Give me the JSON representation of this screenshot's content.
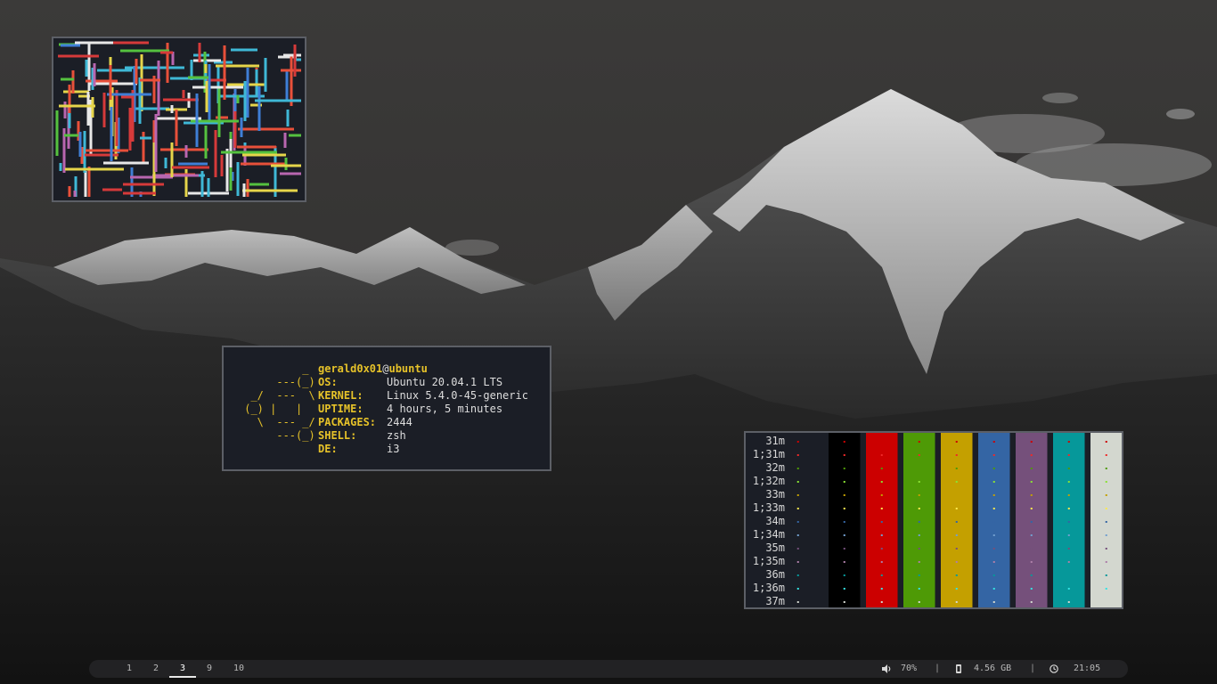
{
  "wallpaper": {
    "description_icon": "mountain-wallpaper"
  },
  "neofetch": {
    "logo_lines": [
      "          _",
      "      ---(_)",
      "  _/  ---  \\",
      " (_) |   |",
      "   \\  --- _/",
      "      ---(_)"
    ],
    "user": "gerald0x01",
    "at": "@",
    "host": "ubuntu",
    "rows": [
      {
        "key": "OS:",
        "value": "Ubuntu 20.04.1 LTS"
      },
      {
        "key": "KERNEL:",
        "value": "Linux 5.4.0-45-generic"
      },
      {
        "key": "UPTIME:",
        "value": "4 hours, 5 minutes"
      },
      {
        "key": "PACKAGES:",
        "value": "2444"
      },
      {
        "key": "SHELL:",
        "value": "zsh"
      },
      {
        "key": "DE:",
        "value": "i3"
      }
    ]
  },
  "colortest": {
    "labels": [
      "31m",
      "1;31m",
      "32m",
      "1;32m",
      "33m",
      "1;33m",
      "34m",
      "1;34m",
      "35m",
      "1;35m",
      "36m",
      "1;36m",
      "37m"
    ],
    "backgrounds": [
      "#1b1e26",
      "#000000",
      "#cc0000",
      "#4e9a06",
      "#c4a000",
      "#3465a4",
      "#75507b",
      "#06989a",
      "#d3d7cf"
    ],
    "dot_colors": [
      "#cc0000",
      "#ef2929",
      "#4e9a06",
      "#8ae234",
      "#c4a000",
      "#fce94f",
      "#3465a4",
      "#729fcf",
      "#75507b",
      "#ad7fa8",
      "#06989a",
      "#34e2e2",
      "#d3d7cf"
    ]
  },
  "statusbar": {
    "workspaces": [
      {
        "label": "1",
        "active": false
      },
      {
        "label": "2",
        "active": false
      },
      {
        "label": "3",
        "active": true
      },
      {
        "label": "9",
        "active": false
      },
      {
        "label": "10",
        "active": false
      }
    ],
    "volume": "70%",
    "separator": "|",
    "memory": "4.56 GB",
    "clock": "21:05",
    "icons": {
      "volume": "speaker-icon",
      "memory": "memory-chip-icon",
      "clock": "clock-icon"
    }
  },
  "pipes_colors": [
    "#e8503a",
    "#e6d54a",
    "#55c13f",
    "#3fb8d6",
    "#3f7fd6",
    "#b866b0",
    "#e8e8e8",
    "#d63a3a"
  ]
}
